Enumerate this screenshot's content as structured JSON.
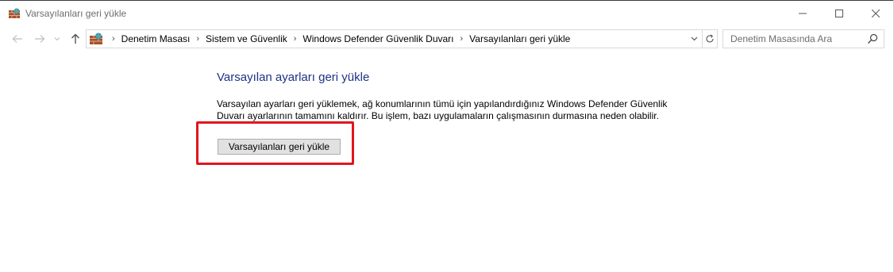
{
  "window": {
    "title": "Varsayılanları geri yükle",
    "icon": "firewall-icon"
  },
  "navigation": {
    "breadcrumbs": [
      "Denetim Masası",
      "Sistem ve Güvenlik",
      "Windows Defender Güvenlik Duvarı",
      "Varsayılanları geri yükle"
    ],
    "search_placeholder": "Denetim Masasında Ara"
  },
  "main": {
    "heading": "Varsayılan ayarları geri yükle",
    "description_line1": "Varsayılan ayarları geri yüklemek, ağ konumlarının tümü için yapılandırdığınız Windows Defender Güvenlik",
    "description_line2": "Duvarı ayarlarının tamamını kaldırır. Bu işlem, bazı uygulamaların çalışmasının durmasına neden olabilir.",
    "restore_button_label": "Varsayılanları geri yükle"
  },
  "colors": {
    "heading": "#1e3287",
    "highlight_border": "#e0161f",
    "button_bg": "#e1e1e1"
  }
}
